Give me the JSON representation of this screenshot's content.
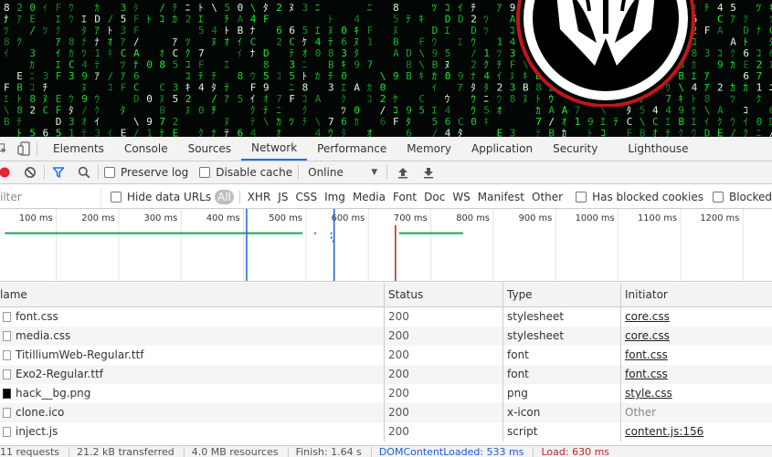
{
  "devtools": {
    "tabs": [
      {
        "label": "Elements"
      },
      {
        "label": "Console"
      },
      {
        "label": "Sources"
      },
      {
        "label": "Network"
      },
      {
        "label": "Performance"
      },
      {
        "label": "Memory"
      },
      {
        "label": "Application"
      },
      {
        "label": "Security"
      },
      {
        "label": "Lighthouse"
      }
    ],
    "active_tab": "Network"
  },
  "toolbar": {
    "preserve_log": "Preserve log",
    "disable_cache": "Disable cache",
    "throttling": "Online"
  },
  "filter": {
    "placeholder": "ilter",
    "hide_data_urls": "Hide data URLs",
    "types": [
      "All",
      "XHR",
      "JS",
      "CSS",
      "Img",
      "Media",
      "Font",
      "Doc",
      "WS",
      "Manifest",
      "Other"
    ],
    "selected_type": "All",
    "has_blocked_cookies": "Has blocked cookies",
    "blocked_requests": "Blocked"
  },
  "timeline": {
    "ticks": [
      "100 ms",
      "200 ms",
      "300 ms",
      "400 ms",
      "500 ms",
      "600 ms",
      "700 ms",
      "800 ms",
      "900 ms",
      "1000 ms",
      "1100 ms",
      "1200 ms"
    ]
  },
  "table": {
    "headers": {
      "name": "Name",
      "status": "Status",
      "type": "Type",
      "initiator": "Initiator"
    },
    "header_name_visible": "lame",
    "rows": [
      {
        "name": "font.css",
        "status": "200",
        "type": "stylesheet",
        "initiator": "core.css",
        "initiator_link": true,
        "icon": "file-icon"
      },
      {
        "name": "media.css",
        "status": "200",
        "type": "stylesheet",
        "initiator": "core.css",
        "initiator_link": true,
        "icon": "file-icon"
      },
      {
        "name": "TitilliumWeb-Regular.ttf",
        "status": "200",
        "type": "font",
        "initiator": "font.css",
        "initiator_link": true,
        "icon": "file-icon"
      },
      {
        "name": "Exo2-Regular.ttf",
        "status": "200",
        "type": "font",
        "initiator": "font.css",
        "initiator_link": true,
        "icon": "file-icon"
      },
      {
        "name": "hack__bg.png",
        "status": "200",
        "type": "png",
        "initiator": "style.css",
        "initiator_link": true,
        "icon": "image-icon"
      },
      {
        "name": "clone.ico",
        "status": "200",
        "type": "x-icon",
        "initiator": "Other",
        "initiator_link": false,
        "icon": "file-icon"
      },
      {
        "name": "inject.js",
        "status": "200",
        "type": "script",
        "initiator": "content.js:156",
        "initiator_link": true,
        "icon": "file-icon"
      }
    ]
  },
  "statusbar": {
    "requests": "11 requests",
    "transferred": "21.2 kB transferred",
    "resources": "4.0 MB resources",
    "finish": "Finish: 1.64 s",
    "dom_content_loaded": "DOMContentLoaded: 533 ms",
    "load": "Load: 630 ms"
  },
  "colors": {
    "accent": "#1a73e8",
    "record": "#e8222e",
    "matrix_green": "#2bd34a",
    "logo_red": "#c0161b"
  },
  "icons": [
    "inspect-icon",
    "device-toolbar-icon",
    "record-icon",
    "clear-icon",
    "filter-icon",
    "search-icon",
    "import-har-icon",
    "export-har-icon"
  ]
}
